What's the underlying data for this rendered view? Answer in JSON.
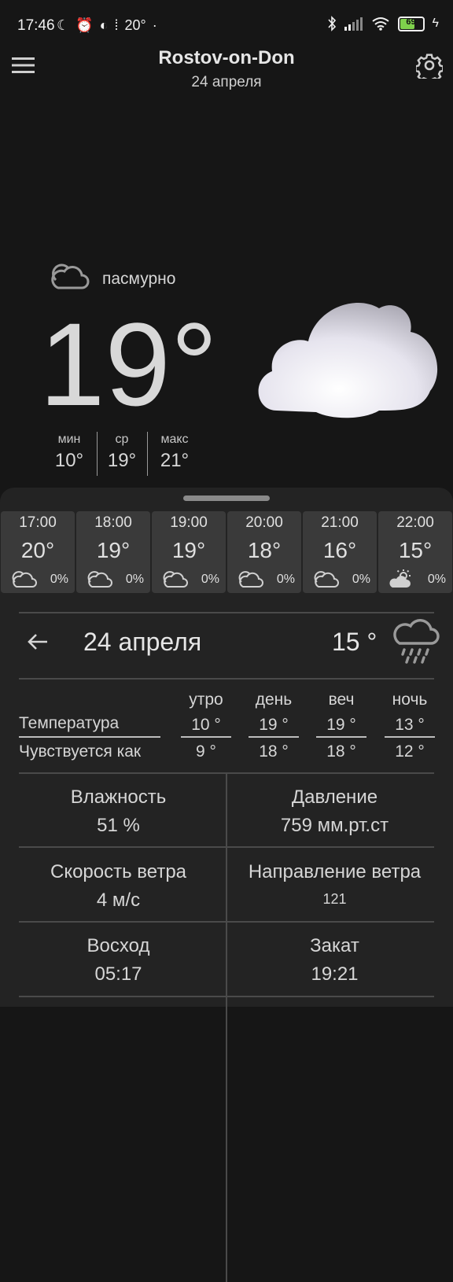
{
  "status": {
    "time": "17:46",
    "temp": "20°",
    "battery": "69",
    "battery_level": 0.69
  },
  "header": {
    "city": "Rostov-on-Don",
    "date": "24 апреля"
  },
  "current": {
    "condition": "пасмурно",
    "temp": "19°",
    "min_label": "мин",
    "min_value": "10°",
    "avg_label": "ср",
    "avg_value": "19°",
    "max_label": "макс",
    "max_value": "21°"
  },
  "hourly": [
    {
      "time": "17:00",
      "temp": "20°",
      "pop": "0%",
      "icon": "cloud-icon"
    },
    {
      "time": "18:00",
      "temp": "19°",
      "pop": "0%",
      "icon": "cloud-icon"
    },
    {
      "time": "19:00",
      "temp": "19°",
      "pop": "0%",
      "icon": "cloud-icon"
    },
    {
      "time": "20:00",
      "temp": "18°",
      "pop": "0%",
      "icon": "cloud-icon"
    },
    {
      "time": "21:00",
      "temp": "16°",
      "pop": "0%",
      "icon": "cloud-icon"
    },
    {
      "time": "22:00",
      "temp": "15°",
      "pop": "0%",
      "icon": "partly-cloudy-icon"
    }
  ],
  "day": {
    "date": "24 апреля",
    "temp": "15 °",
    "columns": [
      "утро",
      "день",
      "веч",
      "ночь"
    ],
    "temperature_label": "Температура",
    "temperature": [
      "10 °",
      "19 °",
      "19 °",
      "13 °"
    ],
    "feels_label": "Чувствуется как",
    "feels": [
      "9 °",
      "18 °",
      "18 °",
      "12 °"
    ]
  },
  "details": {
    "humidity_label": "Влажность",
    "humidity": "51 %",
    "pressure_label": "Давление",
    "pressure": "759 мм.рт.ст",
    "wind_speed_label": "Скорость ветра",
    "wind_speed": "4 м/с",
    "wind_dir_label": "Направление ветра",
    "wind_dir": "121",
    "sunrise_label": "Восход",
    "sunrise": "05:17",
    "sunset_label": "Закат",
    "sunset": "19:21"
  }
}
